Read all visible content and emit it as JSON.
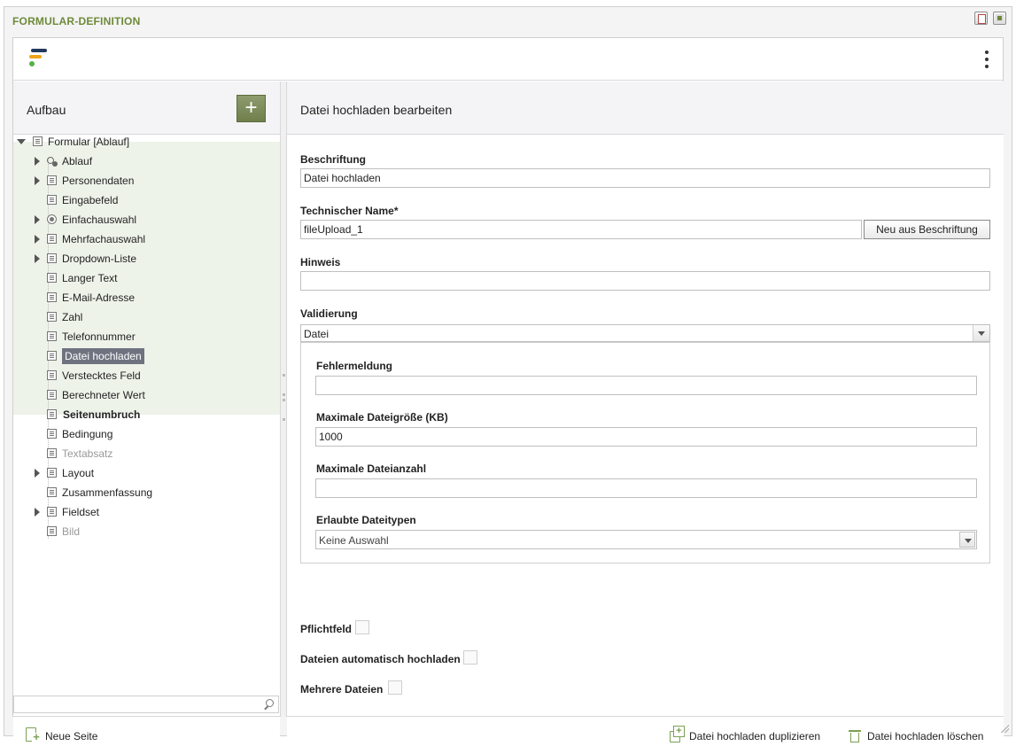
{
  "window": {
    "title": "FORMULAR-DEFINITION"
  },
  "left_panel": {
    "heading": "Aufbau",
    "add_label": "+",
    "tree": [
      {
        "label": "Formular [Ablauf]",
        "expanded": true,
        "level": 0
      },
      {
        "label": "Ablauf",
        "has_children": true
      },
      {
        "label": "Personendaten",
        "has_children": true
      },
      {
        "label": "Eingabefeld",
        "has_children": false
      },
      {
        "label": "Einfachauswahl",
        "has_children": true
      },
      {
        "label": "Mehrfachauswahl",
        "has_children": true
      },
      {
        "label": "Dropdown-Liste",
        "has_children": true
      },
      {
        "label": "Langer Text",
        "has_children": false
      },
      {
        "label": "E-Mail-Adresse",
        "has_children": false
      },
      {
        "label": "Zahl",
        "has_children": false
      },
      {
        "label": "Telefonnummer",
        "has_children": false
      },
      {
        "label": "Datei hochladen",
        "has_children": false,
        "selected": true
      },
      {
        "label": "Verstecktes Feld",
        "has_children": false
      },
      {
        "label": "Berechneter Wert",
        "has_children": false
      },
      {
        "label": "Seitenumbruch",
        "has_children": false,
        "bold": true
      },
      {
        "label": "Bedingung",
        "has_children": false
      },
      {
        "label": "Textabsatz",
        "has_children": false,
        "muted": true
      },
      {
        "label": "Layout",
        "has_children": true
      },
      {
        "label": "Zusammenfassung",
        "has_children": false
      },
      {
        "label": "Fieldset",
        "has_children": true
      },
      {
        "label": "Bild",
        "has_children": false,
        "muted": true
      }
    ],
    "search_value": "",
    "new_page_label": "Neue Seite"
  },
  "right_panel": {
    "heading": "Datei hochladen bearbeiten",
    "fields": {
      "caption_label": "Beschriftung",
      "caption_value": "Datei hochladen",
      "technical_label": "Technischer Name*",
      "technical_value": "fileUpload_1",
      "regenerate_button": "Neu aus Beschriftung",
      "hint_label": "Hinweis",
      "hint_value": "",
      "validation_label": "Validierung",
      "validation_value": "Datei",
      "error_label": "Fehlermeldung",
      "error_value": "",
      "max_size_label": "Maximale Dateigröße (KB)",
      "max_size_value": "1000",
      "max_count_label": "Maximale Dateianzahl",
      "max_count_value": "",
      "types_label": "Erlaubte Dateitypen",
      "types_value": "Keine Auswahl",
      "required_label": "Pflichtfeld",
      "auto_upload_label": "Dateien automatisch hochladen",
      "multiple_label": "Mehrere Dateien"
    },
    "footer": {
      "duplicate_label": "Datei hochladen duplizieren",
      "delete_label": "Datei hochladen löschen"
    }
  },
  "colors": {
    "title": "#6e8a3a",
    "accent": "#7aa053",
    "selected": "#6f7380",
    "tree_highlight": "#eef3ea"
  }
}
